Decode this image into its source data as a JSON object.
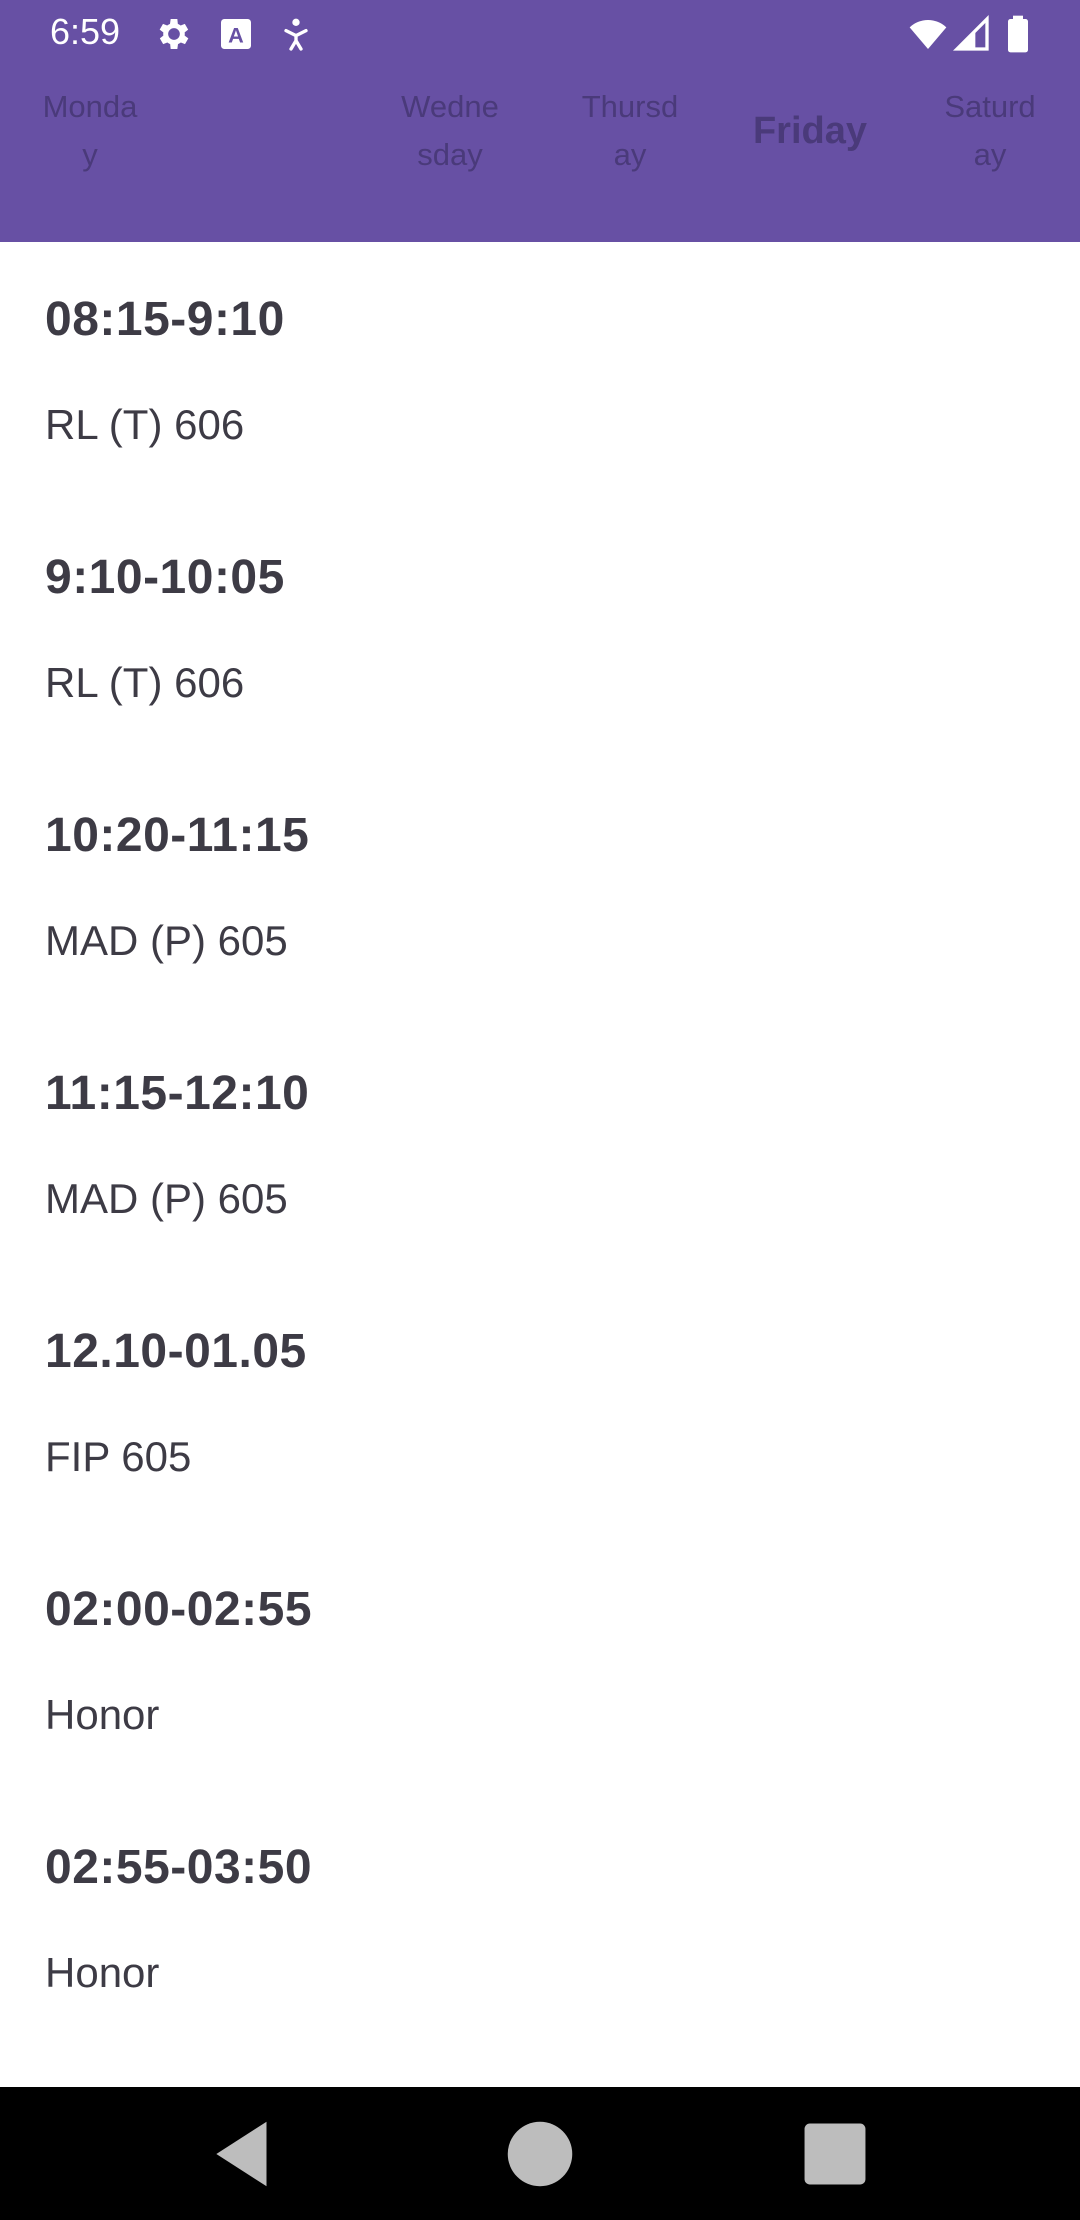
{
  "status_bar": {
    "time": "6:59",
    "left_icons": [
      "settings-icon",
      "keyboard-a-icon",
      "accessibility-icon"
    ],
    "right_icons": [
      "wifi-icon",
      "signal-icon",
      "battery-icon"
    ]
  },
  "tabs": [
    {
      "label": "Monda\ny",
      "active": false
    },
    {
      "label": "",
      "active": false
    },
    {
      "label": "Wedne\nsday",
      "active": false
    },
    {
      "label": "Thursd\nay",
      "active": false
    },
    {
      "label": "Friday",
      "active": true
    },
    {
      "label": "Saturd\nay",
      "active": false
    }
  ],
  "schedule": [
    {
      "time": "08:15-9:10",
      "subject": "RL (T)  606"
    },
    {
      "time": "9:10-10:05",
      "subject": "RL (T)  606"
    },
    {
      "time": "10:20-11:15",
      "subject": "MAD (P) 605"
    },
    {
      "time": "11:15-12:10",
      "subject": "MAD (P) 605"
    },
    {
      "time": "12.10-01.05",
      "subject": "FIP 605"
    },
    {
      "time": "02:00-02:55",
      "subject": "Honor"
    },
    {
      "time": "02:55-03:50",
      "subject": "Honor"
    }
  ],
  "nav_bar": {
    "buttons": [
      "back-icon",
      "home-icon",
      "recents-icon"
    ]
  },
  "colors": {
    "primary": "#6750A4",
    "tab_text": "#4a3a7a",
    "body_text": "#3d3b45"
  }
}
